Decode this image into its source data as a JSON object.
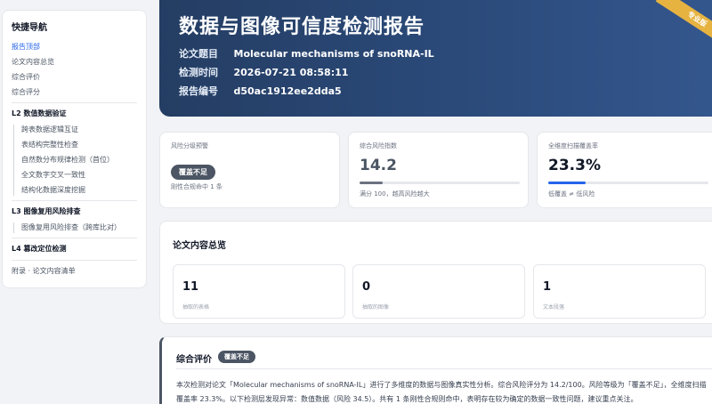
{
  "sidebar": {
    "title": "快捷导航",
    "top_items": [
      "报告顶部",
      "论文内容总览",
      "综合评价",
      "综合评分"
    ],
    "sec_l2": "L2 数值数据验证",
    "l2_items": [
      "跨表数据逻辑互证",
      "表结构完整性检查",
      "自然数分布规律检测（首位）",
      "全文数字交叉一致性",
      "结构化数据深度挖掘"
    ],
    "sec_l3": "L3 图像复用风险排查",
    "l3_items": [
      "图像复用风险排查（跨库比对）"
    ],
    "sec_l4": "L4 篡改定位检测",
    "appendix": "附录 · 论文内容清单"
  },
  "header": {
    "title": "数据与图像可信度检测报告",
    "ribbon": "专业版",
    "rows": [
      {
        "k": "论文题目",
        "v": "Molecular mechanisms of snoRNA-IL"
      },
      {
        "k": "检测时间",
        "v": "2026-07-21 08:58:11"
      },
      {
        "k": "报告编号",
        "v": "d50ac1912ee2dda5"
      }
    ]
  },
  "stats": {
    "risk_level": {
      "label": "风险分级预警",
      "badge": "覆盖不足",
      "note": "刚性合规命中 1 条"
    },
    "risk_index": {
      "label": "综合风险指数",
      "value": "14.2",
      "progress": 0.142,
      "note": "满分 100，越高风险越大",
      "color": "#6b7280"
    },
    "coverage": {
      "label": "全维度扫描覆盖率",
      "value": "23.3%",
      "progress": 0.233,
      "note": "低覆盖 ≠ 低风险",
      "color": "#2563eb"
    }
  },
  "overview": {
    "title": "论文内容总览",
    "cards": [
      {
        "num": "11",
        "label": "抽取的表格"
      },
      {
        "num": "0",
        "label": "抽取的图像"
      },
      {
        "num": "1",
        "label": "文本段落"
      }
    ]
  },
  "summary": {
    "title": "综合评价",
    "badge": "覆盖不足",
    "text": "本次检测对论文「Molecular mechanisms of snoRNA-IL」进行了多维度的数据与图像真实性分析。综合风险评分为 14.2/100。风险等级为「覆盖不足」，全维度扫描覆盖率 23.3%。以下检测层发现异常：数值数据（风险 34.5）。共有 1 条刚性合规则命中，表明存在较为确定的数据一致性问题，建议重点关注。"
  }
}
